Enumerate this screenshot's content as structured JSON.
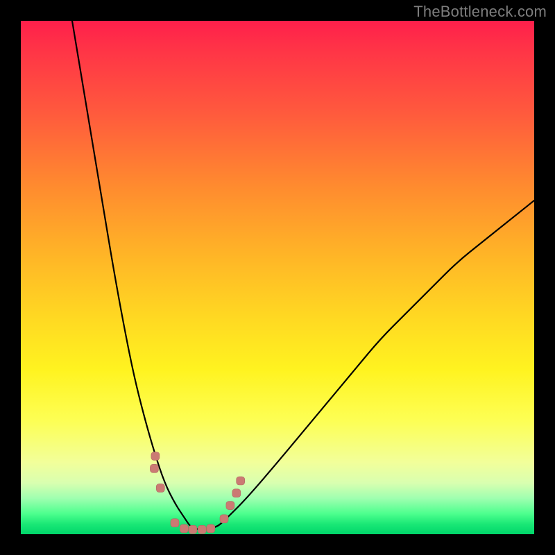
{
  "watermark": "TheBottleneck.com",
  "chart_data": {
    "type": "line",
    "title": "",
    "xlabel": "",
    "ylabel": "",
    "xlim": [
      0,
      100
    ],
    "ylim": [
      0,
      100
    ],
    "grid": false,
    "legend": false,
    "background_gradient": {
      "top": "#ff1f4b",
      "mid": "#fff320",
      "bottom": "#00d66a"
    },
    "series": [
      {
        "name": "bottleneck_curve",
        "x": [
          10,
          12,
          14,
          16,
          18,
          20,
          22,
          24,
          26,
          28,
          30,
          32,
          33,
          34,
          35,
          38,
          40,
          44,
          50,
          55,
          60,
          65,
          70,
          75,
          80,
          85,
          90,
          95,
          100
        ],
        "y": [
          100,
          88,
          76,
          64,
          52,
          41,
          31,
          23,
          16,
          10,
          6,
          3,
          1.5,
          1,
          1,
          1.2,
          3,
          7,
          14,
          20,
          26,
          32,
          38,
          43,
          48,
          53,
          57,
          61,
          65
        ]
      }
    ],
    "markers": [
      {
        "x": 26.2,
        "y": 15.2
      },
      {
        "x": 26.0,
        "y": 12.8
      },
      {
        "x": 27.2,
        "y": 9.0
      },
      {
        "x": 30.0,
        "y": 2.2
      },
      {
        "x": 31.8,
        "y": 1.1
      },
      {
        "x": 33.5,
        "y": 0.9
      },
      {
        "x": 35.3,
        "y": 0.9
      },
      {
        "x": 37.0,
        "y": 1.1
      },
      {
        "x": 39.6,
        "y": 3.0
      },
      {
        "x": 40.8,
        "y": 5.6
      },
      {
        "x": 42.0,
        "y": 8.0
      },
      {
        "x": 42.8,
        "y": 10.4
      }
    ],
    "marker_style": {
      "shape": "rounded-rect",
      "color": "#cb7a73",
      "size": 12
    }
  }
}
